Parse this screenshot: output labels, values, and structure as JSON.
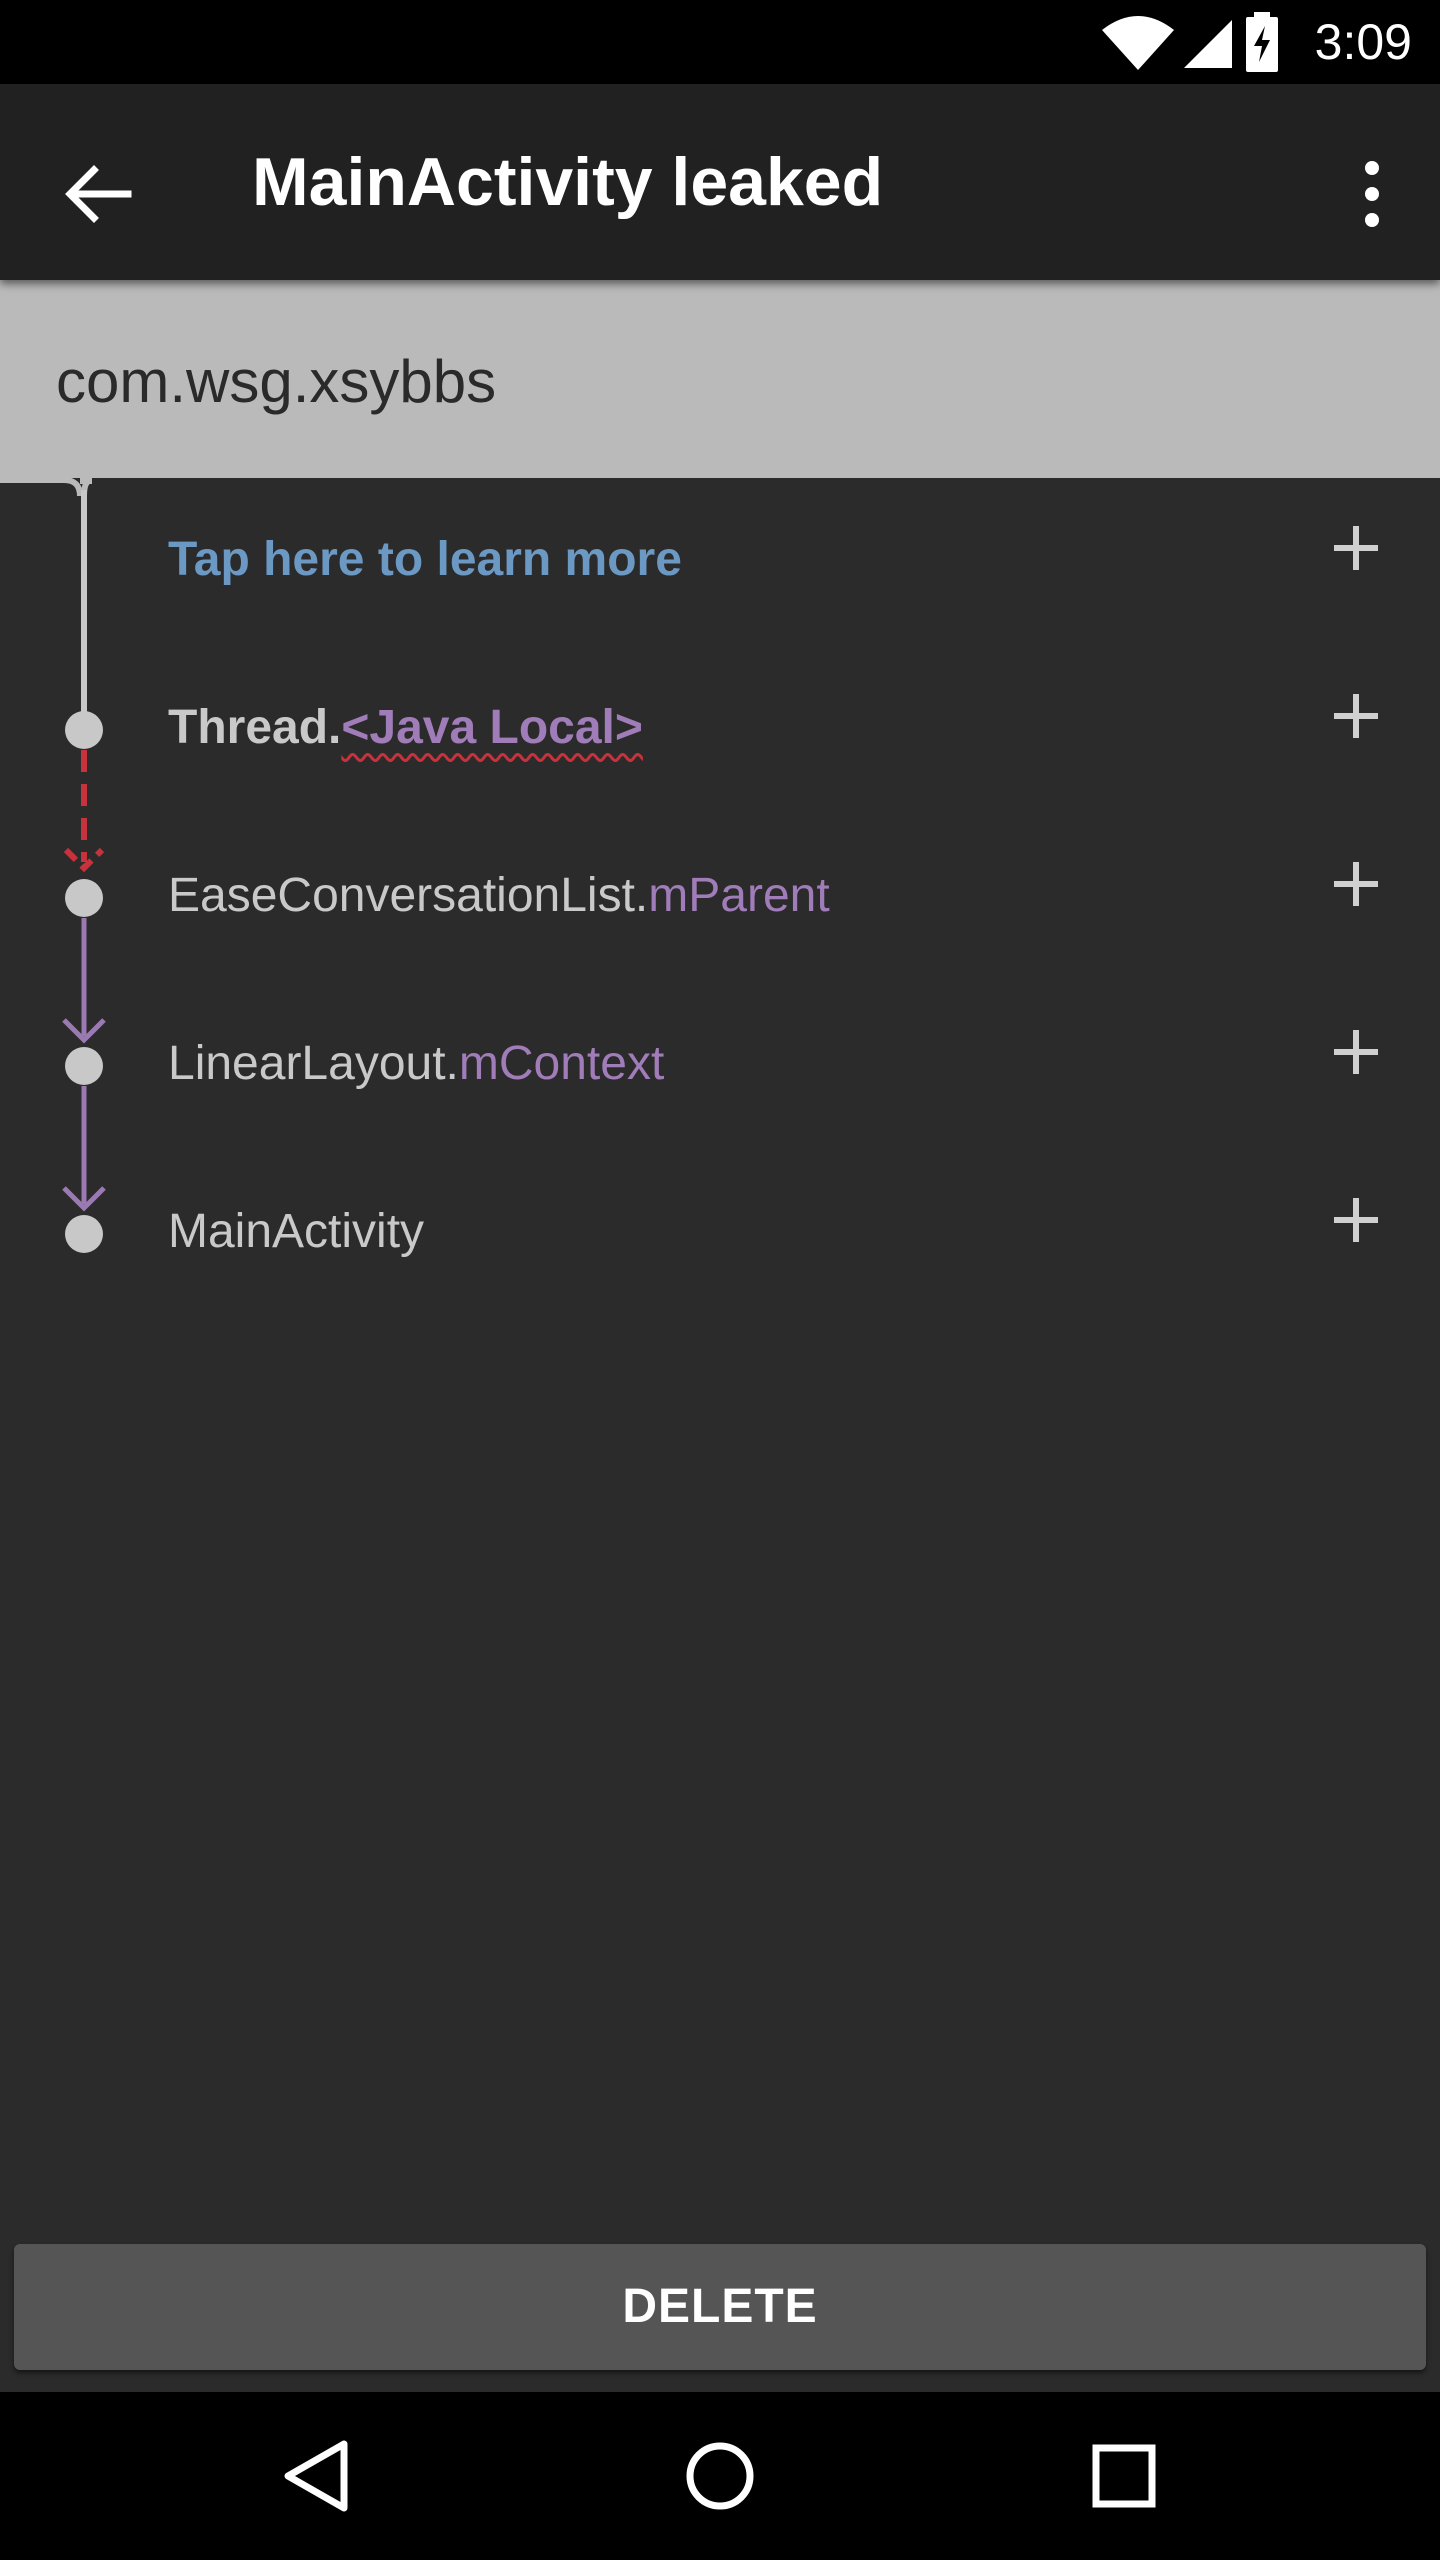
{
  "status_bar": {
    "time": "3:09",
    "icons": [
      "wifi-icon",
      "signal-icon",
      "battery-charging-icon"
    ]
  },
  "app_bar": {
    "title": "MainActivity leaked",
    "back_icon": "arrow-back-icon",
    "menu_icon": "more-vert-icon"
  },
  "package": "com.wsg.xsybbs",
  "trace": [
    {
      "label": "Tap here to learn more",
      "type": "learn-more"
    },
    {
      "class": "Thread.",
      "field": "<Java Local>",
      "type": "root"
    },
    {
      "class": "EaseConversationList.",
      "field": "mParent",
      "type": "ref"
    },
    {
      "class": "LinearLayout.",
      "field": "mContext",
      "type": "ref"
    },
    {
      "class": "MainActivity",
      "field": "",
      "type": "leak"
    }
  ],
  "colors": {
    "learn_more": "#6b99c4",
    "field": "#a07cb8",
    "suspect_arrow": "#c8323c",
    "ref_arrow": "#9b7ab3",
    "background": "#2b2b2b",
    "header": "#bababa"
  },
  "actions": {
    "delete_label": "DELETE"
  },
  "nav_bar": {
    "buttons": [
      "back-nav-icon",
      "home-nav-icon",
      "recents-nav-icon"
    ]
  }
}
